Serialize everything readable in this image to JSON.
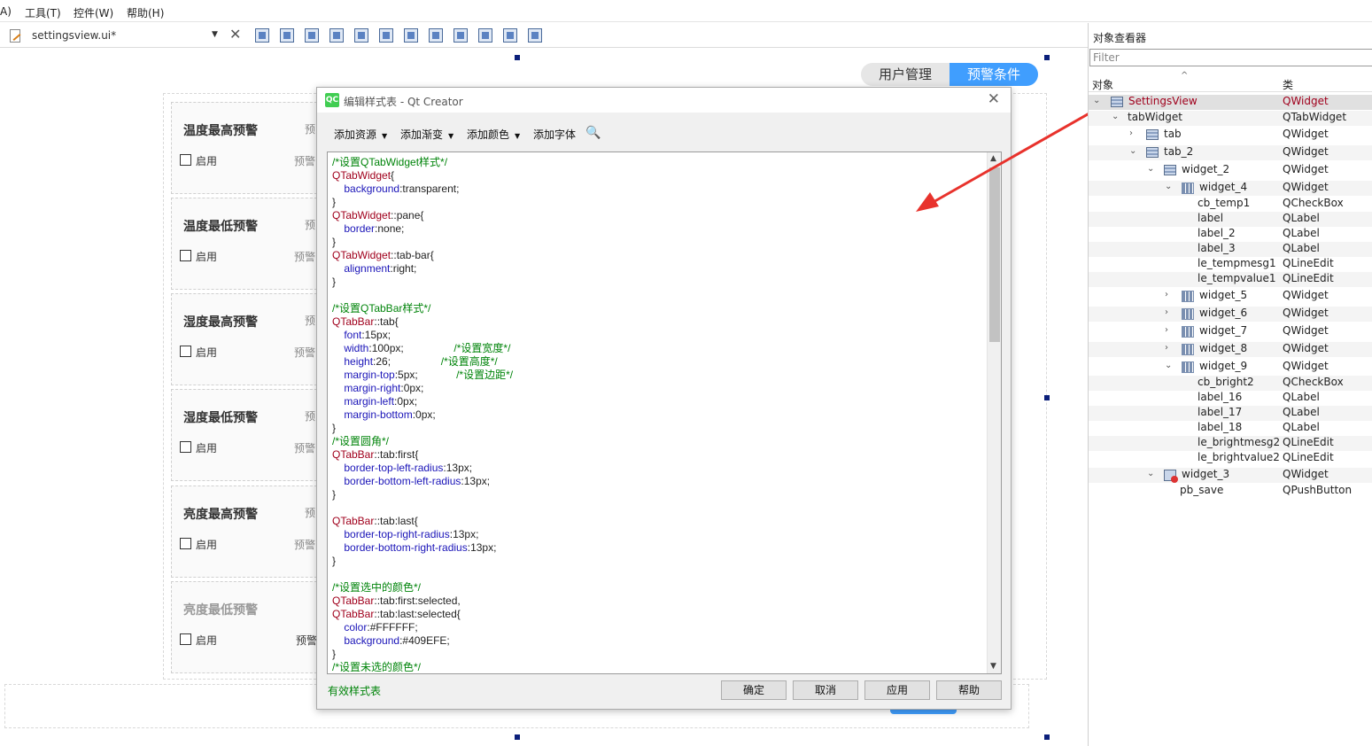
{
  "menubar": {
    "items": [
      "A)",
      "工具(T)",
      "控件(W)",
      "帮助(H)"
    ]
  },
  "toolbar": {
    "filename": "settingsview.ui*"
  },
  "tabs": [
    "用户管理",
    "预警条件"
  ],
  "groups": [
    {
      "title": "温度最高预警",
      "check": "启用",
      "pre1": "预",
      "pre2": "预警"
    },
    {
      "title": "温度最低预警",
      "check": "启用",
      "pre1": "预",
      "pre2": "预警"
    },
    {
      "title": "湿度最高预警",
      "check": "启用",
      "pre1": "预",
      "pre2": "预警"
    },
    {
      "title": "湿度最低预警",
      "check": "启用",
      "pre1": "预",
      "pre2": "预警"
    },
    {
      "title": "亮度最高预警",
      "check": "启用",
      "pre1": "预",
      "pre2": "预警"
    },
    {
      "title": "亮度最低预警",
      "check": "启用",
      "pre1": "",
      "pre2": "预警"
    }
  ],
  "dialog": {
    "title": "编辑样式表 - Qt Creator",
    "toolbar": [
      "添加资源",
      "添加渐变",
      "添加颜色",
      "添加字体"
    ],
    "valid_text": "有效样式表",
    "buttons": [
      "确定",
      "取消",
      "应用",
      "帮助"
    ]
  },
  "inspector": {
    "title": "对象查看器",
    "filter_placeholder": "Filter",
    "col_object": "对象",
    "col_class": "类",
    "rows": [
      {
        "name": "SettingsView",
        "class": "QWidget"
      },
      {
        "name": "tabWidget",
        "class": "QTabWidget"
      },
      {
        "name": "tab",
        "class": "QWidget"
      },
      {
        "name": "tab_2",
        "class": "QWidget"
      },
      {
        "name": "widget_2",
        "class": "QWidget"
      },
      {
        "name": "widget_4",
        "class": "QWidget"
      },
      {
        "name": "cb_temp1",
        "class": "QCheckBox"
      },
      {
        "name": "label",
        "class": "QLabel"
      },
      {
        "name": "label_2",
        "class": "QLabel"
      },
      {
        "name": "label_3",
        "class": "QLabel"
      },
      {
        "name": "le_tempmesg1",
        "class": "QLineEdit"
      },
      {
        "name": "le_tempvalue1",
        "class": "QLineEdit"
      },
      {
        "name": "widget_5",
        "class": "QWidget"
      },
      {
        "name": "widget_6",
        "class": "QWidget"
      },
      {
        "name": "widget_7",
        "class": "QWidget"
      },
      {
        "name": "widget_8",
        "class": "QWidget"
      },
      {
        "name": "widget_9",
        "class": "QWidget"
      },
      {
        "name": "cb_bright2",
        "class": "QCheckBox"
      },
      {
        "name": "label_16",
        "class": "QLabel"
      },
      {
        "name": "label_17",
        "class": "QLabel"
      },
      {
        "name": "label_18",
        "class": "QLabel"
      },
      {
        "name": "le_brightmesg2",
        "class": "QLineEdit"
      },
      {
        "name": "le_brightvalue2",
        "class": "QLineEdit"
      },
      {
        "name": "widget_3",
        "class": "QWidget"
      },
      {
        "name": "pb_save",
        "class": "QPushButton"
      }
    ]
  }
}
